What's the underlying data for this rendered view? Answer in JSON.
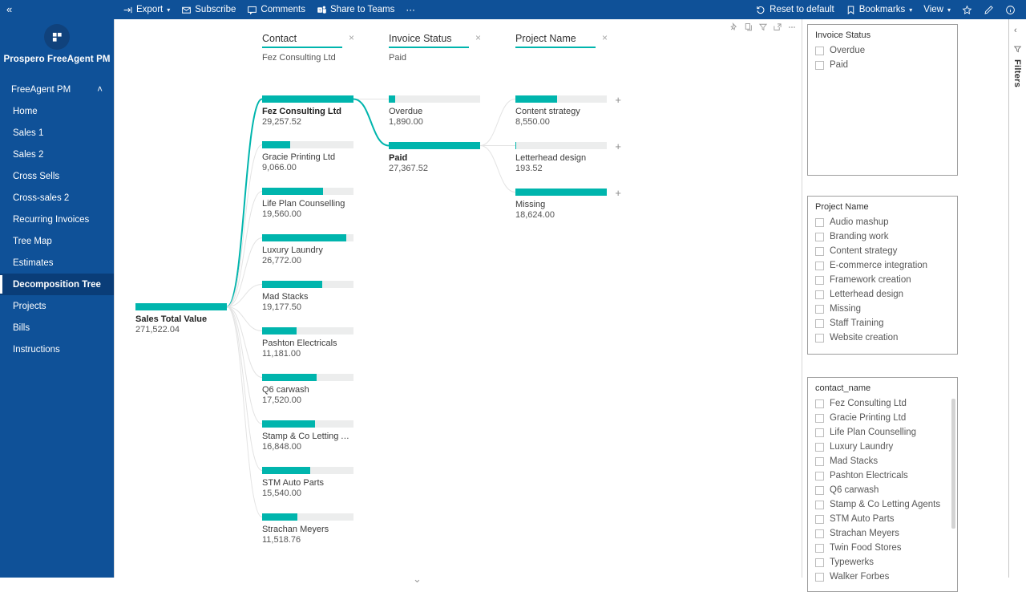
{
  "topbar": {
    "left_items": [
      {
        "label": "Export",
        "icon": "export-icon",
        "has_chevron": true
      },
      {
        "label": "Subscribe",
        "icon": "envelope-icon",
        "has_chevron": false
      },
      {
        "label": "Comments",
        "icon": "comment-icon",
        "has_chevron": false
      },
      {
        "label": "Share to Teams",
        "icon": "teams-icon",
        "has_chevron": false
      },
      {
        "label": "⋯",
        "icon": "more-icon",
        "has_chevron": false
      }
    ],
    "right_items": [
      {
        "label": "Reset to default",
        "icon": "reset-icon",
        "has_chevron": false
      },
      {
        "label": "Bookmarks",
        "icon": "bookmark-icon",
        "has_chevron": true
      },
      {
        "label": "View",
        "icon": "",
        "has_chevron": true
      }
    ],
    "right_icons": [
      {
        "name": "favorite-star-icon"
      },
      {
        "name": "edit-pencil-icon"
      },
      {
        "name": "info-icon"
      }
    ]
  },
  "sidebar": {
    "collapse_icon": "«",
    "brand_name": "Prospero FreeAgent PM",
    "workspace": "FreeAgent PM",
    "workspace_chevron": "˄",
    "items": [
      {
        "label": "Home",
        "active": false
      },
      {
        "label": "Sales 1",
        "active": false
      },
      {
        "label": "Sales 2",
        "active": false
      },
      {
        "label": "Cross Sells",
        "active": false
      },
      {
        "label": "Cross-sales 2",
        "active": false
      },
      {
        "label": "Recurring Invoices",
        "active": false
      },
      {
        "label": "Tree Map",
        "active": false
      },
      {
        "label": "Estimates",
        "active": false
      },
      {
        "label": "Decomposition Tree",
        "active": true
      },
      {
        "label": "Projects",
        "active": false
      },
      {
        "label": "Bills",
        "active": false
      },
      {
        "label": "Instructions",
        "active": false
      }
    ]
  },
  "visual_header_icons": [
    {
      "name": "pin-icon"
    },
    {
      "name": "copy-icon"
    },
    {
      "name": "filter-icon"
    },
    {
      "name": "focus-mode-icon"
    },
    {
      "name": "more-options-icon"
    }
  ],
  "colors": {
    "accent_teal": "#00b5ad",
    "brand_blue": "#0f5198",
    "track_gray": "#eceded"
  },
  "tree": {
    "expand_more_icon": "⌄",
    "levels": [
      {
        "title": "Contact",
        "selected": "Fez Consulting Ltd",
        "close_icon": "×"
      },
      {
        "title": "Invoice Status",
        "selected": "Paid",
        "close_icon": "×"
      },
      {
        "title": "Project Name",
        "selected": "",
        "close_icon": "×"
      }
    ],
    "root": {
      "label": "Sales Total Value",
      "value": "271,522.04",
      "selected": true,
      "bar_pct": 100
    }
  },
  "chart_data": {
    "type": "bar",
    "title": "Sales Total Value — Decomposition Tree",
    "measure": "Sales Total Value",
    "root": {
      "label": "Sales Total Value",
      "value": 271522.04
    },
    "levels": [
      "Contact",
      "Invoice Status",
      "Project Name"
    ],
    "level_1": {
      "field": "Contact",
      "categories": [
        "Fez Consulting Ltd",
        "Gracie Printing Ltd",
        "Life Plan Counselling",
        "Luxury Laundry",
        "Mad Stacks",
        "Pashton Electricals",
        "Q6 carwash",
        "Stamp & Co Letting A...",
        "STM Auto Parts",
        "Strachan Meyers"
      ],
      "values": [
        29257.52,
        9066.0,
        19560.0,
        26772.0,
        19177.5,
        11181.0,
        17520.0,
        16848.0,
        15540.0,
        11518.76
      ],
      "value_labels": [
        "29,257.52",
        "9,066.00",
        "19,560.00",
        "26,772.00",
        "19,177.50",
        "11,181.00",
        "17,520.00",
        "16,848.00",
        "15,540.00",
        "11,518.76"
      ],
      "selected": "Fez Consulting Ltd",
      "bar_pcts": [
        100,
        31,
        67,
        92,
        66,
        38,
        60,
        58,
        53,
        39
      ]
    },
    "level_2": {
      "field": "Invoice Status",
      "parent": "Fez Consulting Ltd",
      "categories": [
        "Overdue",
        "Paid"
      ],
      "values": [
        1890.0,
        27367.52
      ],
      "value_labels": [
        "1,890.00",
        "27,367.52"
      ],
      "selected": "Paid",
      "bar_pcts": [
        7,
        100
      ]
    },
    "level_3": {
      "field": "Project Name",
      "parent": "Paid",
      "categories": [
        "Content strategy",
        "Letterhead design",
        "Missing"
      ],
      "values": [
        8550.0,
        193.52,
        18624.0
      ],
      "value_labels": [
        "8,550.00",
        "193.52",
        "18,624.00"
      ],
      "selected": null,
      "bar_pcts": [
        46,
        1,
        100
      ]
    },
    "xlabel": "",
    "ylabel": "Sales Total Value",
    "grid": false,
    "legend": "none"
  },
  "filters": {
    "rail": {
      "label": "Filters",
      "collapse_icon": "‹",
      "filter_icon": "filter-icon"
    },
    "cards": [
      {
        "title": "Invoice Status",
        "items": [
          "Overdue",
          "Paid"
        ],
        "scroll": false
      },
      {
        "title": "Project Name",
        "items": [
          "Audio mashup",
          "Branding work",
          "Content strategy",
          "E-commerce integration",
          "Framework creation",
          "Letterhead design",
          "Missing",
          "Staff Training",
          "Website creation"
        ],
        "scroll": false
      },
      {
        "title": "contact_name",
        "items": [
          "Fez Consulting Ltd",
          "Gracie Printing Ltd",
          "Life Plan Counselling",
          "Luxury Laundry",
          "Mad Stacks",
          "Pashton Electricals",
          "Q6 carwash",
          "Stamp & Co Letting Agents",
          "STM Auto Parts",
          "Strachan Meyers",
          "Twin Food Stores",
          "Typewerks",
          "Walker Forbes"
        ],
        "scroll": true
      }
    ]
  }
}
